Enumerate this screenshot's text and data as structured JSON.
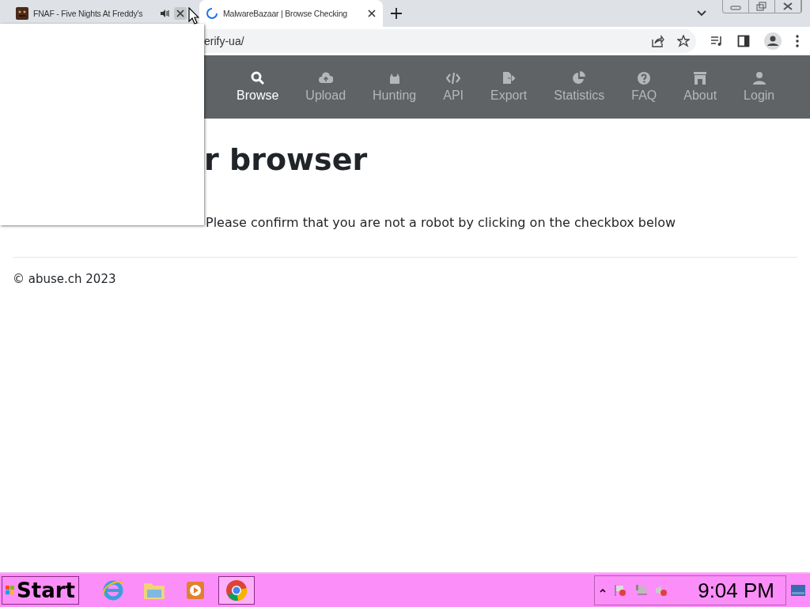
{
  "tabs": [
    {
      "title": "FNAF - Five Nights At Freddy's",
      "selected": false,
      "kind": "audio"
    },
    {
      "title": "MalwareBazaar | Browse Checking",
      "selected": true,
      "kind": "loading"
    }
  ],
  "address": {
    "value": "erify-ua/"
  },
  "nav": [
    {
      "label": "Browse",
      "selected": true
    },
    {
      "label": "Upload",
      "selected": false
    },
    {
      "label": "Hunting",
      "selected": false
    },
    {
      "label": "API",
      "selected": false
    },
    {
      "label": "Export",
      "selected": false
    },
    {
      "label": "Statistics",
      "selected": false
    },
    {
      "label": "FAQ",
      "selected": false
    },
    {
      "label": "About",
      "selected": false
    },
    {
      "label": "Login",
      "selected": false
    }
  ],
  "heading": "r browser",
  "message": "Please confirm that you are not a robot by clicking on the checkbox below",
  "footer": "© abuse.ch 2023",
  "taskbar": {
    "start": "Start",
    "apps": [
      {
        "selected": false
      },
      {
        "selected": false
      },
      {
        "selected": false
      },
      {
        "selected": true
      }
    ],
    "clock": "9:04 PM"
  }
}
